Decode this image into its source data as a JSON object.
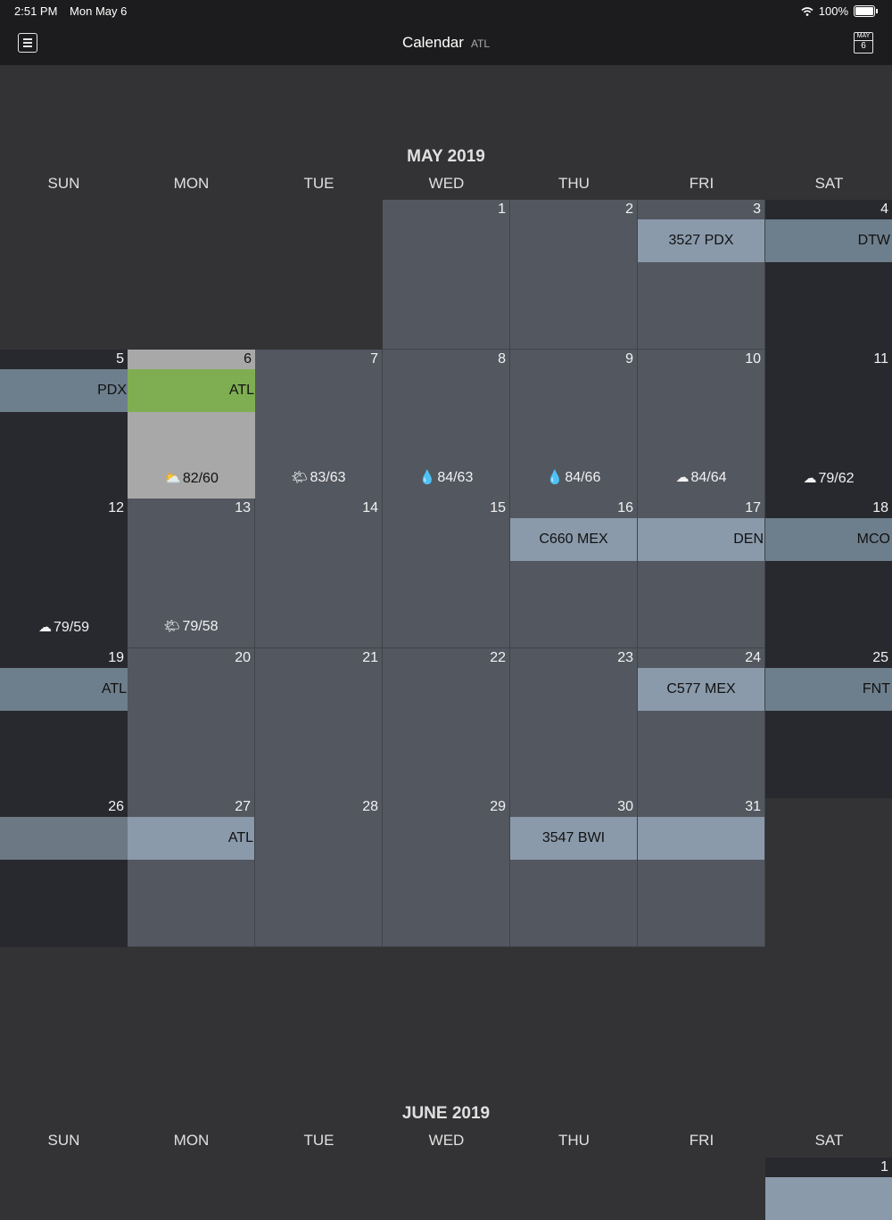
{
  "status": {
    "time": "2:51 PM",
    "date": "Mon May 6",
    "battery": "100%"
  },
  "nav": {
    "title": "Calendar",
    "subtitle": "ATL",
    "cal_icon_month": "MAY",
    "cal_icon_day": "6"
  },
  "months": [
    {
      "title": "MAY 2019",
      "dows": [
        "SUN",
        "MON",
        "TUE",
        "WED",
        "THU",
        "FRI",
        "SAT"
      ],
      "days": [
        {
          "n": "1",
          "style": "active"
        },
        {
          "n": "2",
          "style": "active"
        },
        {
          "n": "3",
          "style": "active",
          "event": "3527 PDX",
          "event_style": "light"
        },
        {
          "n": "4",
          "style": "dim",
          "event": "DTW",
          "event_style": "mid"
        },
        {
          "n": "5",
          "style": "dim",
          "event": "PDX",
          "event_style": "mid"
        },
        {
          "n": "6",
          "style": "today",
          "event": "ATL",
          "event_style": "green",
          "weather_icon": "partly-cloudy",
          "temp": "82/60"
        },
        {
          "n": "7",
          "style": "active",
          "weather_icon": "sunny",
          "temp": "83/63"
        },
        {
          "n": "8",
          "style": "active",
          "weather_icon": "rain-drop",
          "temp": "84/63"
        },
        {
          "n": "9",
          "style": "active",
          "weather_icon": "rain-drop",
          "temp": "84/66"
        },
        {
          "n": "10",
          "style": "active",
          "weather_icon": "cloudy",
          "temp": "84/64"
        },
        {
          "n": "11",
          "style": "dim",
          "weather_icon": "cloudy",
          "temp": "79/62"
        },
        {
          "n": "12",
          "style": "dim",
          "weather_icon": "cloudy",
          "temp": "79/59"
        },
        {
          "n": "13",
          "style": "active",
          "weather_icon": "sunny",
          "temp": "79/58"
        },
        {
          "n": "14",
          "style": "active"
        },
        {
          "n": "15",
          "style": "active"
        },
        {
          "n": "16",
          "style": "active",
          "event": "C660 MEX",
          "event_style": "light"
        },
        {
          "n": "17",
          "style": "active",
          "event": "DEN",
          "event_style": "light-right"
        },
        {
          "n": "18",
          "style": "dim",
          "event": "MCO",
          "event_style": "mid"
        },
        {
          "n": "19",
          "style": "dim",
          "event": "ATL",
          "event_style": "mid"
        },
        {
          "n": "20",
          "style": "active"
        },
        {
          "n": "21",
          "style": "active"
        },
        {
          "n": "22",
          "style": "active"
        },
        {
          "n": "23",
          "style": "active"
        },
        {
          "n": "24",
          "style": "active",
          "event": "C577 MEX",
          "event_style": "light"
        },
        {
          "n": "25",
          "style": "dim",
          "event": "FNT",
          "event_style": "mid"
        },
        {
          "n": "26",
          "style": "dim",
          "event": "",
          "event_style": "gray2"
        },
        {
          "n": "27",
          "style": "active",
          "event": "ATL",
          "event_style": "light-right"
        },
        {
          "n": "28",
          "style": "active"
        },
        {
          "n": "29",
          "style": "active"
        },
        {
          "n": "30",
          "style": "active",
          "event": "3547 BWI",
          "event_style": "light"
        },
        {
          "n": "31",
          "style": "active",
          "event": "",
          "event_style": "light"
        }
      ]
    },
    {
      "title": "JUNE 2019",
      "dows": [
        "SUN",
        "MON",
        "TUE",
        "WED",
        "THU",
        "FRI",
        "SAT"
      ],
      "days": [
        {
          "n": "1",
          "style": "dim",
          "event": "",
          "event_style": "light"
        }
      ]
    }
  ]
}
